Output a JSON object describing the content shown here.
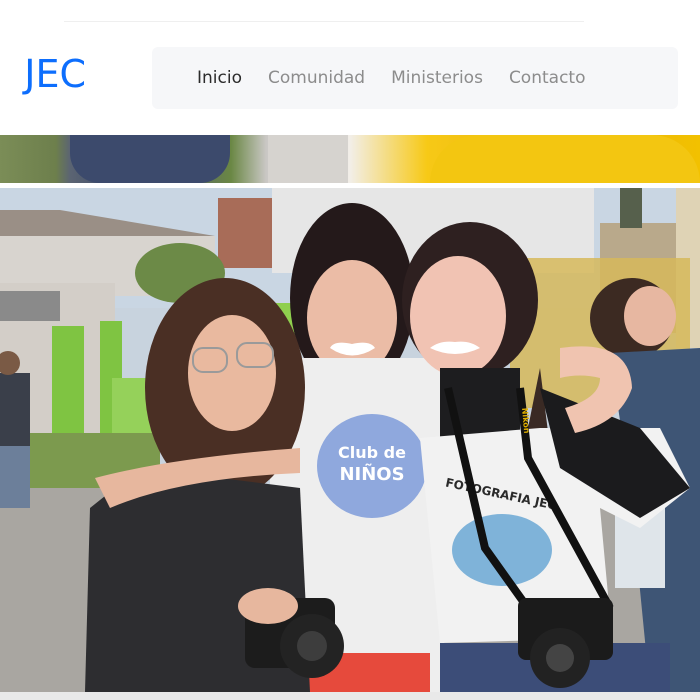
{
  "header": {
    "brand": "JEC"
  },
  "nav": {
    "items": [
      {
        "label": "Inicio",
        "active": true
      },
      {
        "label": "Comunidad",
        "active": false
      },
      {
        "label": "Ministerios",
        "active": false
      },
      {
        "label": "Contacto",
        "active": false
      }
    ]
  },
  "photo": {
    "shirt_text_1": "Club de",
    "shirt_text_2": "NIÑOS",
    "shirt_text_3": "FOTOGRAFIA JEC",
    "strap_text": "Nikon"
  },
  "colors": {
    "brand": "#0d6efd",
    "nav_bg": "#f6f7f9",
    "nav_active": "#2b2b2b",
    "nav_inactive": "#8c8c8c"
  }
}
